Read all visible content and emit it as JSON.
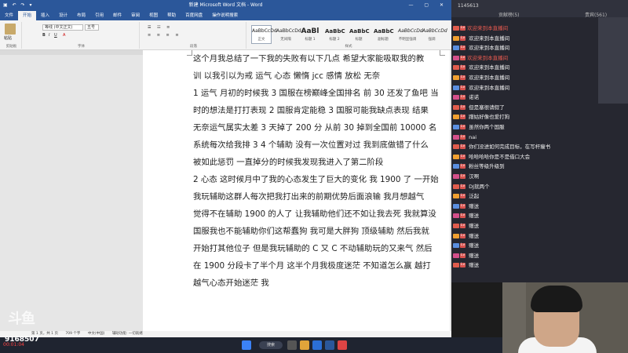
{
  "window": {
    "title": "新建 Microsoft Word 文档 - Word"
  },
  "ribbon_tabs": [
    "文件",
    "开始",
    "插入",
    "设计",
    "布局",
    "引用",
    "邮件",
    "审阅",
    "视图",
    "帮助",
    "百度网盘",
    "操作说明搜索"
  ],
  "ribbon": {
    "paste": "粘贴",
    "clipboard": "剪贴板",
    "font_name": "等线 (中文正文)",
    "font_size": "五号",
    "font_group": "字体",
    "paragraph_group": "段落",
    "styles_group": "样式",
    "styles": [
      {
        "preview": "AaBbCcDd",
        "label": "正文"
      },
      {
        "preview": "AaBbCcDd",
        "label": "无间隔"
      },
      {
        "preview": "AaBl",
        "label": "标题 1"
      },
      {
        "preview": "AaBbC",
        "label": "标题 2"
      },
      {
        "preview": "AaBbC",
        "label": "标题"
      },
      {
        "preview": "AaBbC",
        "label": "副标题"
      },
      {
        "preview": "AaBbCcDd",
        "label": "不明显强调"
      },
      {
        "preview": "AaBbCcDd",
        "label": "强调"
      }
    ]
  },
  "document_lines": [
    "这个月我总结了一下我的失败有以下几点  希望大家能吸取我的教",
    "训  以我引以为戒    运气  心态    懒惰    jcc    感情  放松  无奈",
    "1 运气  月初的时候我 3 国服在榜巅峰全国排名  前 30 还发了鱼吧  当",
    "时的想法是打打表现  2 国服肯定能稳    3 国服可能我缺点表现  结果",
    "无奈运气属实太差  3 天掉了 200 分  从前 30 掉到全国前 10000 名",
    "系统每次给我排  3  4  个辅助  没有一次位置对过  我到底做错了什么",
    "被如此惩罚  一直掉分的时候我发现我进入了第二阶段",
    "2 心态  这时候月中了我的心态发生了巨大的变化  我 1900 了  一开始",
    "我玩辅助这群人每次把我打出来的前期优势后面浪输  我月想越气",
    "觉得不在辅助 1900 的人了  让我辅助他们还不如让我去死  我就算没",
    "国服我也不能辅助你们这帮蠢狗  我可是大胖狗  顶级辅助  然后我就",
    "开始打其他位子  但是我玩辅助的 C 又 C 不动辅助玩的又来气  然后",
    "在  1900  分段卡了半个月  这半个月我极度迷茫  不知道怎么赢  越打",
    "越气心态开始迷茫  我"
  ],
  "statusbar": {
    "page": "第 1 页，共 1 页",
    "words": "709 个字",
    "lang": "中文(中国)",
    "access": "辅助功能: 一切就绪"
  },
  "taskbar": {
    "search": "搜索"
  },
  "stream": {
    "watermark": "斗鱼",
    "viewer_id": "9168507",
    "timer": "00:01:04"
  },
  "chat": {
    "viewer_count": "1145613",
    "header_left": "贡献榜(5)",
    "header_right": "贵宾(561)",
    "messages": [
      {
        "user": "欢迎来到本直播间",
        "text": ""
      },
      {
        "user": "",
        "text": "欢迎来到本直播间"
      },
      {
        "user": "",
        "text": "欢迎来到本直播间"
      },
      {
        "user": "欢迎来到本直播间",
        "text": ""
      },
      {
        "user": "",
        "text": "欢迎来到本直播间"
      },
      {
        "user": "",
        "text": "欢迎来到本直播间"
      },
      {
        "user": "",
        "text": "欢迎来到本直播间"
      },
      {
        "user": "",
        "text": "诺诺"
      },
      {
        "user": "",
        "text": "但是塞很请假了"
      },
      {
        "user": "",
        "text": "蹭姑好像也爱打狗"
      },
      {
        "user": "",
        "text": "虽然你两个国服"
      },
      {
        "user": "",
        "text": "nai"
      },
      {
        "user": "",
        "text": "你们没进如何完成目标，在写杆瘦书"
      },
      {
        "user": "",
        "text": "哈哈哈哈你是不是借口大会"
      },
      {
        "user": "",
        "text": "粉丝等级升级到"
      },
      {
        "user": "",
        "text": "汉啊"
      },
      {
        "user": "",
        "text": "DJ就两个"
      },
      {
        "user": "",
        "text": "泛起"
      },
      {
        "user": "",
        "text": "赠送"
      },
      {
        "user": "",
        "text": "赠送"
      },
      {
        "user": "",
        "text": "赠送"
      },
      {
        "user": "",
        "text": "赠送"
      },
      {
        "user": "",
        "text": "赠送"
      },
      {
        "user": "",
        "text": "赠送"
      },
      {
        "user": "",
        "text": "赠送"
      }
    ]
  },
  "colors": {
    "word_blue": "#2b579a",
    "chat_bg": "#262730",
    "username_red": "#e85a4f"
  }
}
